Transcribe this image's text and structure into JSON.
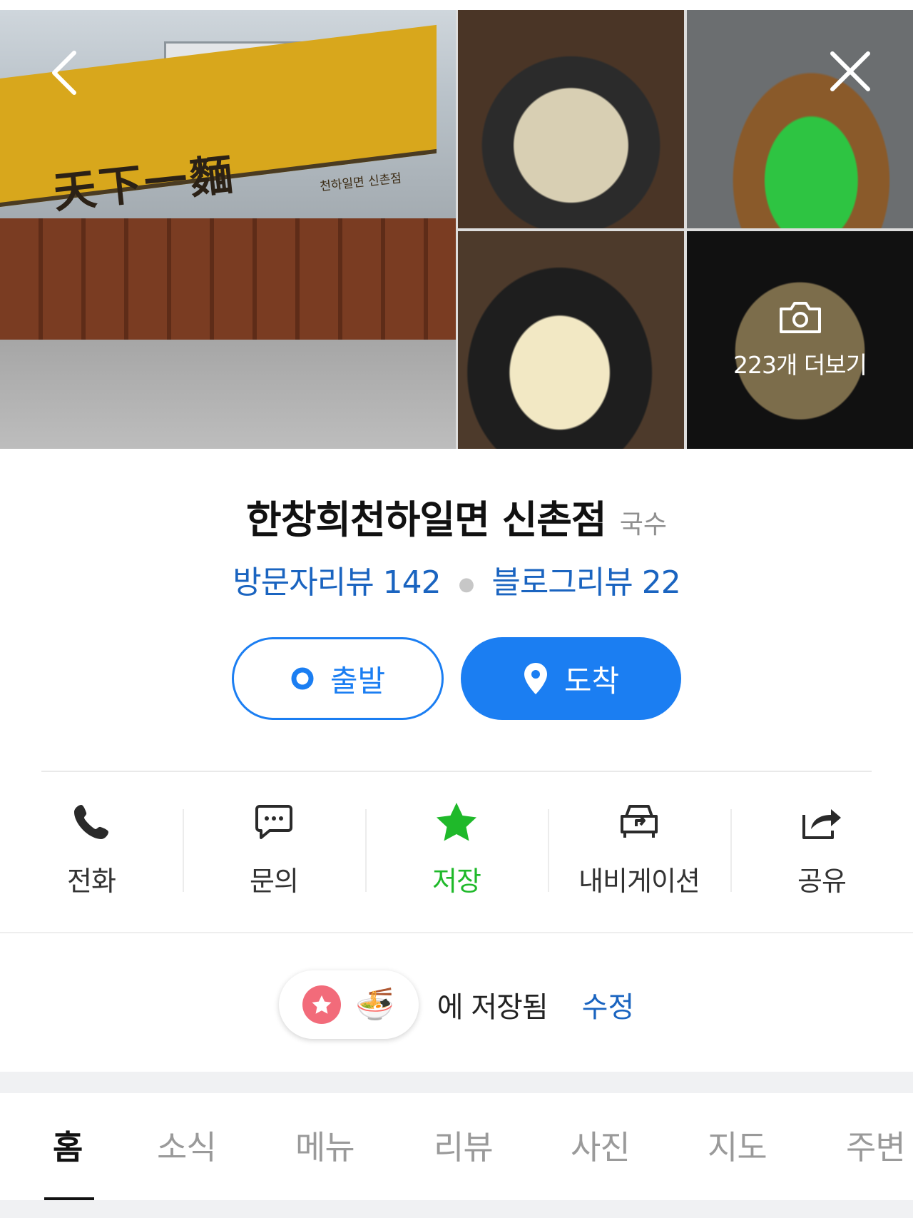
{
  "gallery": {
    "main_sign_text": "天下一麵",
    "main_sign_subtext": "천하일면 신촌점",
    "more_photos_label": "223개 더보기",
    "back_icon": "chevron-left-icon",
    "close_icon": "close-icon",
    "camera_icon": "camera-icon"
  },
  "place": {
    "name": "한창희천하일면 신촌점",
    "category": "국수",
    "visitor_reviews": "방문자리뷰 142",
    "blog_reviews": "블로그리뷰 22"
  },
  "route": {
    "depart_label": "출발",
    "arrive_label": "도착",
    "accent_color": "#1b7ef2"
  },
  "actions": [
    {
      "label": "전화",
      "icon": "phone-icon"
    },
    {
      "label": "문의",
      "icon": "chat-bubble-icon"
    },
    {
      "label": "저장",
      "icon": "star-icon",
      "active_color": "#1fb92a"
    },
    {
      "label": "내비게이션",
      "icon": "car-navigation-icon"
    },
    {
      "label": "공유",
      "icon": "share-icon"
    }
  ],
  "saved": {
    "text": "에 저장됨",
    "edit_label": "수정",
    "folder_icons": [
      "star-icon",
      "noodle-bowl-icon"
    ]
  },
  "tabs": [
    {
      "label": "홈",
      "active": true
    },
    {
      "label": "소식",
      "active": false
    },
    {
      "label": "메뉴",
      "active": false
    },
    {
      "label": "리뷰",
      "active": false
    },
    {
      "label": "사진",
      "active": false
    },
    {
      "label": "지도",
      "active": false
    },
    {
      "label": "주변",
      "active": false
    }
  ]
}
